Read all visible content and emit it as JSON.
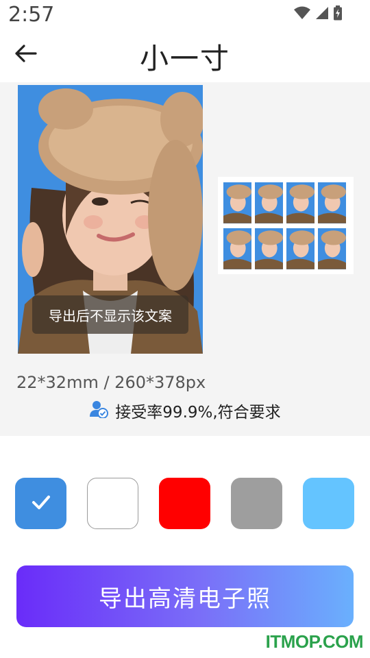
{
  "status_bar": {
    "time": "2:57",
    "icons": [
      "wifi-icon",
      "cell-signal-icon",
      "battery-charging-icon"
    ]
  },
  "app_bar": {
    "title": "小一寸",
    "back_icon": "back-arrow-icon"
  },
  "preview": {
    "overlay_text": "导出后不显示该文案",
    "background_color": "#3f8ee0",
    "print_sheet": {
      "rows": 2,
      "columns": 4
    }
  },
  "size_info": "22*32mm / 260*378px",
  "acceptance": {
    "text": "接受率99.9%,符合要求",
    "icon": "verified-user-icon"
  },
  "background_colors": [
    {
      "name": "blue",
      "hex": "#3f8ee0",
      "selected": true
    },
    {
      "name": "white",
      "hex": "#ffffff",
      "selected": false
    },
    {
      "name": "red",
      "hex": "#ff0000",
      "selected": false
    },
    {
      "name": "gray",
      "hex": "#9e9e9e",
      "selected": false
    },
    {
      "name": "light-blue",
      "hex": "#64c4ff",
      "selected": false
    }
  ],
  "export_button": {
    "label": "导出高清电子照"
  },
  "watermark": "ITMOP.COM"
}
